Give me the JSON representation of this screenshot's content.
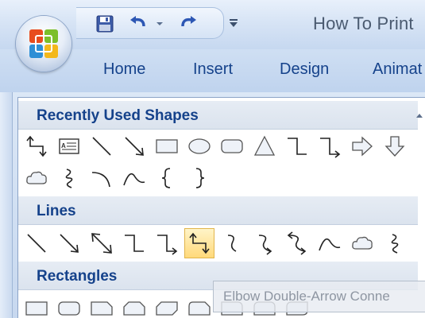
{
  "window": {
    "title": "How To Print"
  },
  "qat": {
    "save_icon": "save-icon",
    "undo_icon": "undo-icon",
    "redo_icon": "redo-icon",
    "customize_icon": "customize-quick-access-icon"
  },
  "tabs": [
    {
      "label": "Home"
    },
    {
      "label": "Insert"
    },
    {
      "label": "Design"
    },
    {
      "label": "Animat"
    }
  ],
  "gallery": {
    "sections": [
      {
        "title": "Recently Used Shapes"
      },
      {
        "title": "Lines"
      },
      {
        "title": "Rectangles"
      }
    ],
    "recent_shapes_row1": [
      "elbow-double-arrow-connector",
      "text-box",
      "line",
      "arrow",
      "rectangle",
      "oval",
      "rounded-rectangle",
      "triangle",
      "elbow-connector",
      "elbow-arrow-connector",
      "right-arrow",
      "down-arrow"
    ],
    "recent_shapes_row2": [
      "cloud",
      "scribble",
      "arc",
      "curve",
      "left-brace",
      "right-brace"
    ],
    "lines": [
      "line",
      "arrow",
      "double-arrow",
      "elbow-connector",
      "elbow-arrow-connector",
      "elbow-double-arrow-connector",
      "curved-connector",
      "curved-arrow-connector",
      "curved-double-arrow-connector",
      "curve",
      "freeform",
      "scribble"
    ],
    "selected_line": "elbow-double-arrow-connector",
    "rectangles": [
      "rectangle",
      "rounded-rectangle",
      "snip-single-corner",
      "snip-same-side",
      "snip-diagonal",
      "snip-round-single",
      "round-single-corner",
      "round-same-side",
      "round-diagonal"
    ]
  },
  "tooltip": {
    "text": "Elbow Double-Arrow Conne"
  },
  "colors": {
    "ribbon_text": "#15428b",
    "selection_fill": "#ffd97a",
    "gallery_header": "#dbe3ee"
  }
}
